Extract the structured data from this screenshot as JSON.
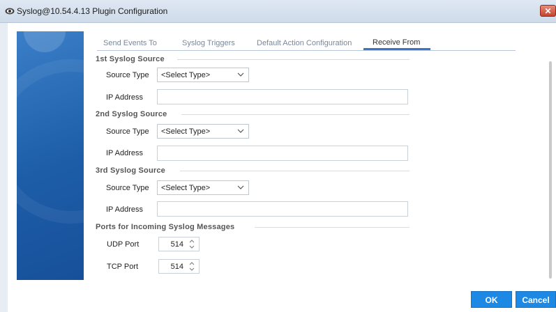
{
  "window": {
    "title": "Syslog@10.54.4.13 Plugin Configuration",
    "close_label": "✕"
  },
  "tabs": [
    {
      "label": "Send Events To"
    },
    {
      "label": "Syslog Triggers"
    },
    {
      "label": "Default Action Configuration"
    },
    {
      "label": "Receive From"
    }
  ],
  "sources": [
    {
      "title": "1st Syslog Source",
      "source_type_label": "Source Type",
      "source_type_value": "<Select Type>",
      "ip_label": "IP Address",
      "ip_value": ""
    },
    {
      "title": "2nd Syslog Source",
      "source_type_label": "Source Type",
      "source_type_value": "<Select Type>",
      "ip_label": "IP Address",
      "ip_value": ""
    },
    {
      "title": "3rd Syslog Source",
      "source_type_label": "Source Type",
      "source_type_value": "<Select Type>",
      "ip_label": "IP Address",
      "ip_value": ""
    }
  ],
  "ports": {
    "title": "Ports for Incoming Syslog Messages",
    "udp_label": "UDP Port",
    "udp_value": "514",
    "tcp_label": "TCP Port",
    "tcp_value": "514"
  },
  "buttons": {
    "ok": "OK",
    "cancel": "Cancel"
  },
  "colors": {
    "accent": "#1e88e5",
    "banner": "#1d5da8",
    "close": "#c5432e"
  },
  "icons": {
    "title": "eye-icon",
    "dropdown": "chevron-down-icon",
    "spinner": "spinner-arrows-icon"
  }
}
